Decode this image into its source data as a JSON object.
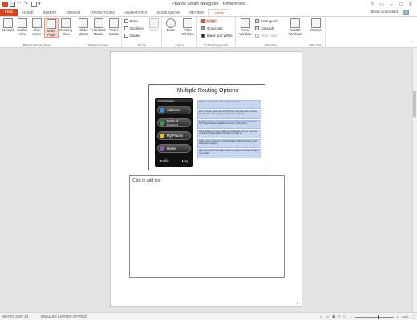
{
  "window": {
    "title": "Pharos Smart Navigator - PowerPoint",
    "user": "Brian Underdahl"
  },
  "ribbon_tabs": [
    "FILE",
    "HOME",
    "INSERT",
    "DESIGN",
    "TRANSITIONS",
    "ANIMATIONS",
    "SLIDE SHOW",
    "REVIEW",
    "VIEW"
  ],
  "active_tab": "VIEW",
  "groups": {
    "presentation_views": {
      "label": "Presentation Views",
      "buttons": [
        "Normal",
        "Outline View",
        "Slide Sorter",
        "Notes Page",
        "Reading View"
      ]
    },
    "master_views": {
      "label": "Master Views",
      "buttons": [
        "Slide Master",
        "Handout Master",
        "Notes Master"
      ]
    },
    "show": {
      "label": "Show",
      "checkboxes": [
        "Ruler",
        "Gridlines",
        "Guides"
      ],
      "notes_button": "Notes"
    },
    "zoom": {
      "label": "Zoom",
      "buttons": [
        "Zoom",
        "Fit to Window"
      ]
    },
    "color": {
      "label": "Color/Grayscale",
      "options": [
        "Color",
        "Grayscale",
        "Black and White"
      ]
    },
    "window": {
      "label": "Window",
      "new_window": "New Window",
      "options": [
        "Arrange All",
        "Cascade",
        "Move Split"
      ],
      "switch": "Switch Windows"
    },
    "macros": {
      "label": "Macros",
      "button": "Macros"
    }
  },
  "slide": {
    "title": "Multiple Routing Options",
    "phone_buttons": [
      "Address",
      "Point of Interest",
      "My Places",
      "Home"
    ],
    "phone_bottom": {
      "left": "Traffic",
      "right": "Map"
    },
    "phone_top_label": "Smart Navigator",
    "descriptions": [
      "Address - Enter specific address as a Destination.",
      "Point of Interest - Search the specific POI in main map source. Choose from list of the nearest within a given radius or category.",
      "My Places - Choose from your Favourite locations, Recent Destinations, and Contacts location established in device, Synchronised.",
      "Home - Routes you to the location you designated as Home. If you have not defined a home location, this allows you to do so.",
      "Traffic - Gives you access to Smart Navigator Traffic information service. Subscription required.",
      "Map - Returns you to the main screen. The system is still active in map or route display."
    ]
  },
  "notes": {
    "placeholder": "Click to add text"
  },
  "page_number": "3",
  "status": {
    "slide_info": "NOTES 3 OF 13",
    "language": "ENGLISH (UNITED STATES)",
    "zoom": "83%"
  },
  "colors": {
    "accent": "#d24726",
    "desc_fill": "#c6d6ef"
  }
}
